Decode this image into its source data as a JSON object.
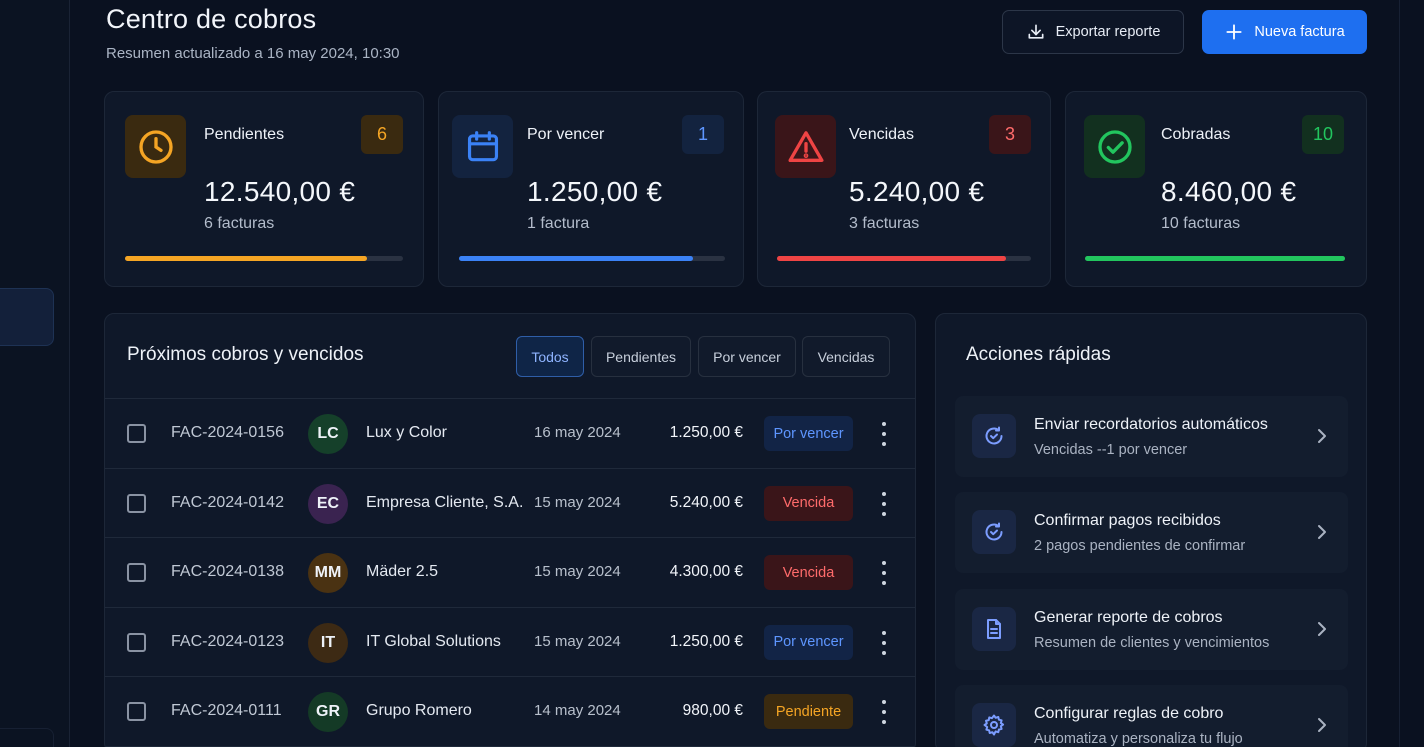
{
  "header": {
    "title": "Centro de cobros",
    "subtitle": "Resumen actualizado a 16 may 2024, 10:30",
    "export_label": "Exportar reporte",
    "new_label": "Nueva factura"
  },
  "stats": [
    {
      "label": "Pendientes",
      "count": "6",
      "amount": "12.540,00 €",
      "sub": "6 facturas",
      "icon": "clock-icon",
      "color": "#f5a524",
      "progress": 0.87
    },
    {
      "label": "Por vencer",
      "count": "1",
      "amount": "1.250,00 €",
      "sub": "1 factura",
      "icon": "calendar-icon",
      "color": "#3b82f6",
      "progress": 0.88
    },
    {
      "label": "Vencidas",
      "count": "3",
      "amount": "5.240,00 €",
      "sub": "3 facturas",
      "icon": "warning-icon",
      "color": "#ef4444",
      "progress": 0.9
    },
    {
      "label": "Cobradas",
      "count": "10",
      "amount": "8.460,00 €",
      "sub": "10 facturas",
      "icon": "check-circle-icon",
      "color": "#22c55e",
      "progress": 1.0
    }
  ],
  "list": {
    "title": "Próximos cobros y vencidos",
    "filters": [
      "Todos",
      "Pendientes",
      "Por vencer",
      "Vencidas"
    ],
    "active_filter": "Todos",
    "rows": [
      {
        "invoice": "FAC-2024-0156",
        "initials": "LC",
        "avatar_color": "#15402a",
        "client": "Lux y Color",
        "date": "16 may 2024",
        "amount": "1.250,00 €",
        "status": "Por vencer",
        "status_type": "por"
      },
      {
        "invoice": "FAC-2024-0142",
        "initials": "EC",
        "avatar_color": "#3a2350",
        "client": "Empresa Cliente, S.A.",
        "date": "15 may 2024",
        "amount": "5.240,00 €",
        "status": "Vencida",
        "status_type": "venc"
      },
      {
        "invoice": "FAC-2024-0138",
        "initials": "MM",
        "avatar_color": "#4a3212",
        "client": "Mäder 2.5",
        "date": "15 may 2024",
        "amount": "4.300,00 €",
        "status": "Vencida",
        "status_type": "venc"
      },
      {
        "invoice": "FAC-2024-0123",
        "initials": "IT",
        "avatar_color": "#3d2a14",
        "client": "IT Global Solutions",
        "date": "15 may 2024",
        "amount": "1.250,00 €",
        "status": "Por vencer",
        "status_type": "por"
      },
      {
        "invoice": "FAC-2024-0111",
        "initials": "GR",
        "avatar_color": "#143a26",
        "client": "Grupo Romero",
        "date": "14 may 2024",
        "amount": "980,00 €",
        "status": "Pendiente",
        "status_type": "pend"
      }
    ]
  },
  "actions": {
    "title": "Acciones rápidas",
    "items": [
      {
        "title": "Enviar recordatorios automáticos",
        "sub": "Vencidas --1 por vencer",
        "icon": "refresh-check-icon"
      },
      {
        "title": "Confirmar pagos recibidos",
        "sub": "2 pagos pendientes de confirmar",
        "icon": "refresh-check-icon"
      },
      {
        "title": "Generar reporte de cobros",
        "sub": "Resumen de clientes y vencimientos",
        "icon": "document-icon"
      },
      {
        "title": "Configurar reglas de cobro",
        "sub": "Automatiza y personaliza tu flujo",
        "icon": "gear-icon"
      }
    ]
  }
}
